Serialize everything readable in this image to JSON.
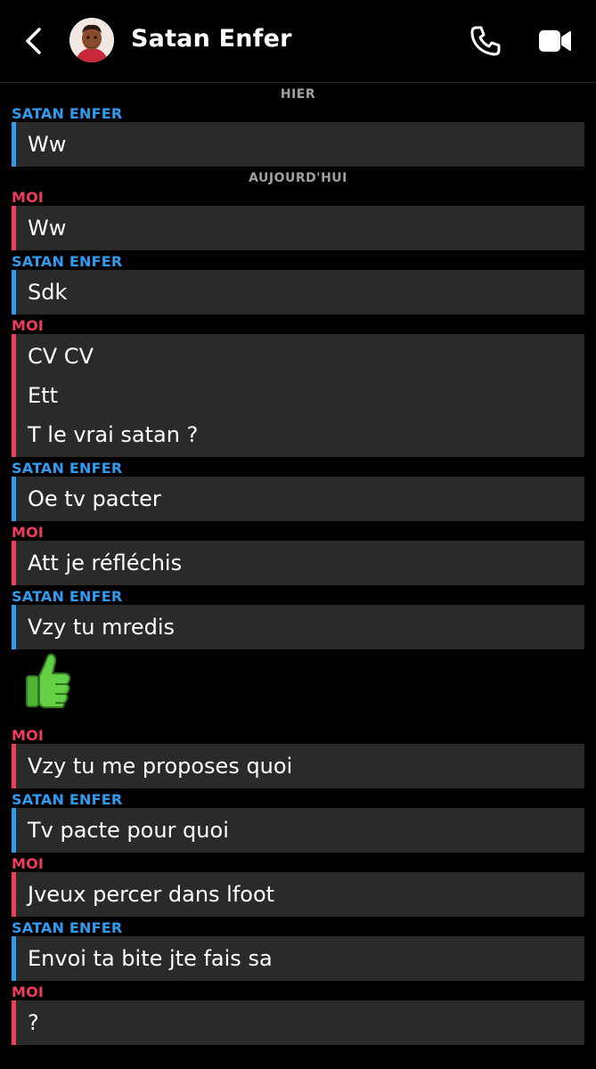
{
  "header": {
    "title": "Satan Enfer",
    "back_icon": "chevron-left-icon",
    "call_icon": "phone-icon",
    "video_icon": "video-camera-icon"
  },
  "colors": {
    "them": "#2e9cf0",
    "me": "#f03d5a",
    "bubble": "#2a2a2a"
  },
  "chat": [
    {
      "kind": "day",
      "text": "HIER"
    },
    {
      "kind": "sender",
      "who": "them",
      "text": "SATAN ENFER"
    },
    {
      "kind": "msg",
      "who": "them",
      "lines": [
        "Ww"
      ]
    },
    {
      "kind": "day",
      "text": "AUJOURD'HUI"
    },
    {
      "kind": "sender",
      "who": "me",
      "text": "MOI"
    },
    {
      "kind": "msg",
      "who": "me",
      "lines": [
        "Ww"
      ]
    },
    {
      "kind": "sender",
      "who": "them",
      "text": "SATAN ENFER"
    },
    {
      "kind": "msg",
      "who": "them",
      "lines": [
        "Sdk"
      ]
    },
    {
      "kind": "sender",
      "who": "me",
      "text": "MOI"
    },
    {
      "kind": "msg",
      "who": "me",
      "lines": [
        "CV CV",
        "Ett",
        "T le vrai satan ?"
      ]
    },
    {
      "kind": "sender",
      "who": "them",
      "text": "SATAN ENFER"
    },
    {
      "kind": "msg",
      "who": "them",
      "lines": [
        "Oe tv pacter"
      ]
    },
    {
      "kind": "sender",
      "who": "me",
      "text": "MOI"
    },
    {
      "kind": "msg",
      "who": "me",
      "lines": [
        "Att je réfléchis"
      ]
    },
    {
      "kind": "sender",
      "who": "them",
      "text": "SATAN ENFER"
    },
    {
      "kind": "msg",
      "who": "them",
      "lines": [
        "Vzy tu mredis"
      ]
    },
    {
      "kind": "emoji",
      "who": "them",
      "icon": "thumbs-up-icon"
    },
    {
      "kind": "sender",
      "who": "me",
      "text": "MOI"
    },
    {
      "kind": "msg",
      "who": "me",
      "lines": [
        "Vzy tu me proposes quoi"
      ]
    },
    {
      "kind": "sender",
      "who": "them",
      "text": "SATAN ENFER"
    },
    {
      "kind": "msg",
      "who": "them",
      "lines": [
        "Tv pacte pour quoi"
      ]
    },
    {
      "kind": "sender",
      "who": "me",
      "text": "MOI"
    },
    {
      "kind": "msg",
      "who": "me",
      "lines": [
        "Jveux percer dans lfoot"
      ]
    },
    {
      "kind": "sender",
      "who": "them",
      "text": "SATAN ENFER"
    },
    {
      "kind": "msg",
      "who": "them",
      "lines": [
        "Envoi ta bite jte fais sa"
      ]
    },
    {
      "kind": "sender",
      "who": "me",
      "text": "MOI"
    },
    {
      "kind": "msg",
      "who": "me",
      "lines": [
        "?"
      ]
    }
  ]
}
